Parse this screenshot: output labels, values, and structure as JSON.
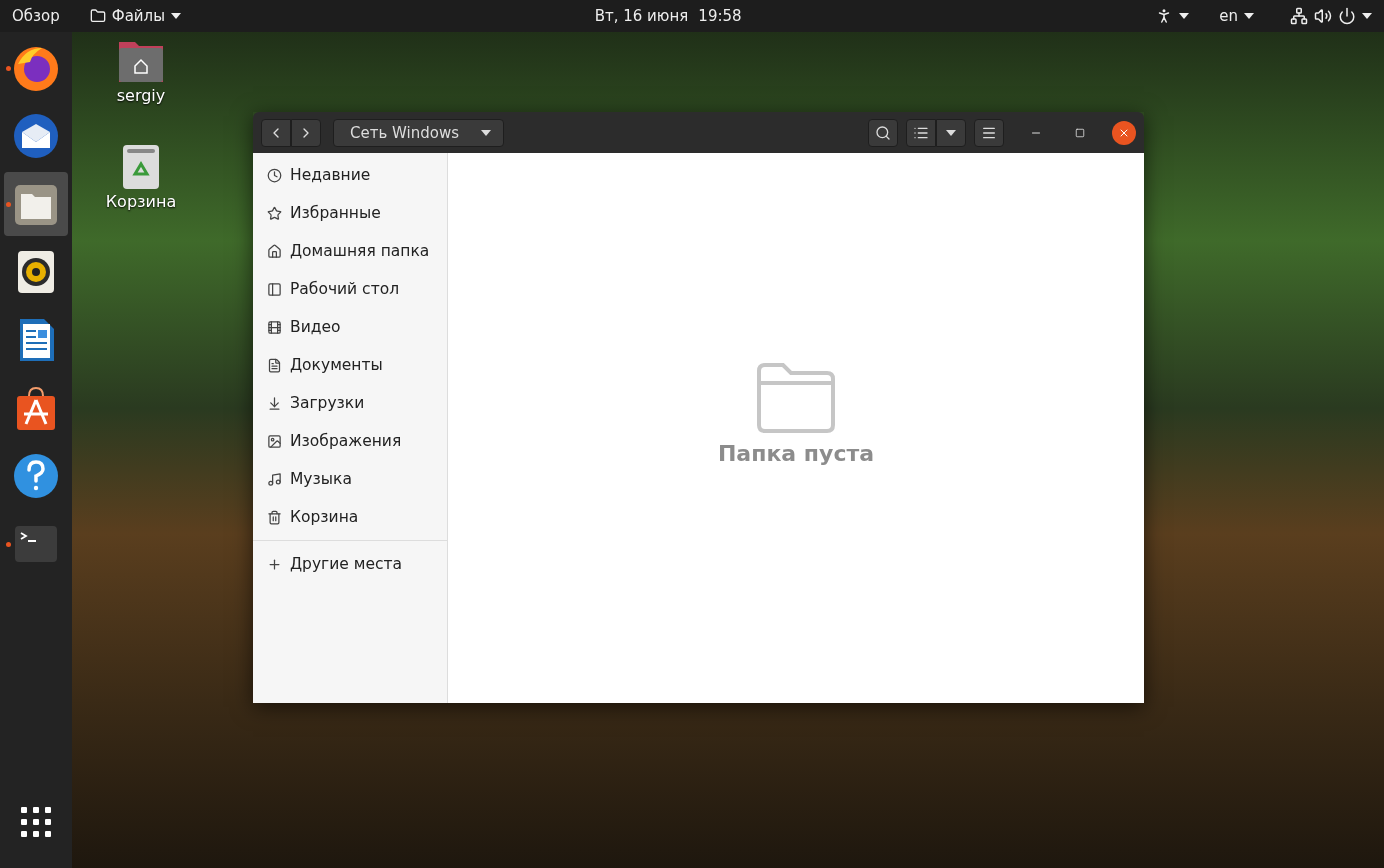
{
  "top_bar": {
    "activities": "Обзор",
    "app_menu": "Файлы",
    "date": "Вт, 16 июня",
    "time": "19:58",
    "keyboard_layout": "en"
  },
  "dock": {
    "apps": [
      {
        "kind": "firefox",
        "running": true,
        "selected": false
      },
      {
        "kind": "thunderbird",
        "running": false,
        "selected": false
      },
      {
        "kind": "files",
        "running": true,
        "selected": true
      },
      {
        "kind": "rhythmbox",
        "running": false,
        "selected": false
      },
      {
        "kind": "writer",
        "running": false,
        "selected": false
      },
      {
        "kind": "software",
        "running": false,
        "selected": false
      },
      {
        "kind": "help",
        "running": false,
        "selected": false
      },
      {
        "kind": "terminal",
        "running": true,
        "selected": false
      }
    ]
  },
  "desktop_icons": [
    {
      "kind": "home",
      "label": "sergiy"
    },
    {
      "kind": "trash",
      "label": "Корзина"
    }
  ],
  "window": {
    "location": "Сеть Windows",
    "sidebar": {
      "items": [
        {
          "label": "Недавние"
        },
        {
          "label": "Избранные"
        },
        {
          "label": "Домашняя папка"
        },
        {
          "label": "Рабочий стол"
        },
        {
          "label": "Видео"
        },
        {
          "label": "Документы"
        },
        {
          "label": "Загрузки"
        },
        {
          "label": "Изображения"
        },
        {
          "label": "Музыка"
        },
        {
          "label": "Корзина"
        }
      ],
      "other": {
        "label": "Другие места"
      }
    },
    "empty_message": "Папка пуста"
  }
}
